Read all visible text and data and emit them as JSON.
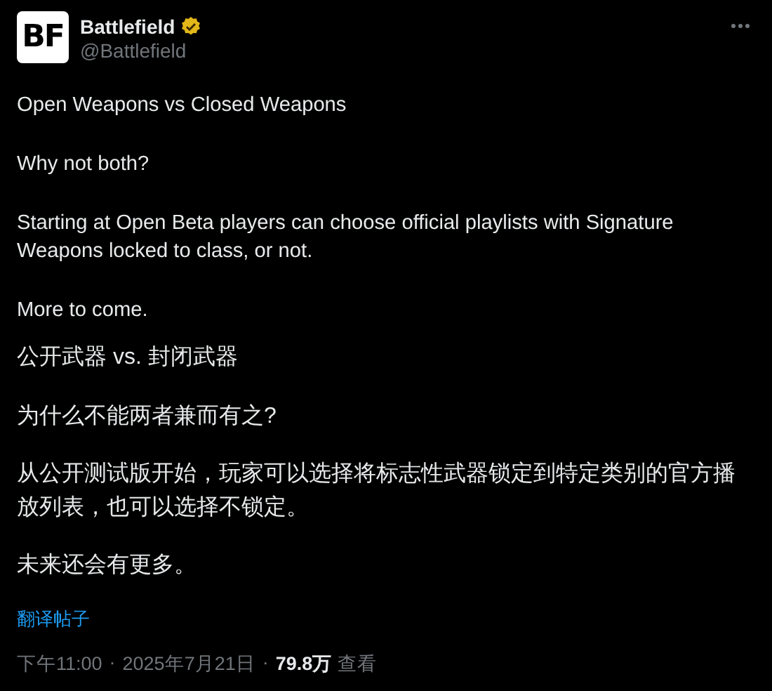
{
  "author": {
    "avatar_text": "BF",
    "name": "Battlefield",
    "verified": true,
    "handle": "@Battlefield"
  },
  "post": {
    "paragraphs": [
      "Open Weapons vs Closed Weapons",
      "Why not both?",
      "Starting at Open Beta players can choose official playlists with Signature Weapons locked to class, or not.",
      "More to come."
    ],
    "translated_paragraphs": [
      "公开武器 vs. 封闭武器",
      "为什么不能两者兼而有之?",
      "从公开测试版开始，玩家可以选择将标志性武器锁定到特定类别的官方播放列表，也可以选择不锁定。",
      "未来还会有更多。"
    ]
  },
  "translate_link": "翻译帖子",
  "meta": {
    "time": "下午11:00",
    "separator": "·",
    "date": "2025年7月21日",
    "views_count": "79.8万",
    "views_label": "查看"
  }
}
